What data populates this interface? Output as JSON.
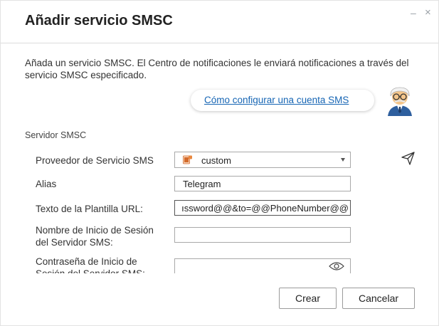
{
  "dialog": {
    "title": "Añadir servicio SMSC",
    "minimize": "–",
    "close": "×",
    "description": "Añada un servicio SMSC. El Centro de notificaciones le enviará notificaciones a través del servicio SMSC especificado.",
    "help_link": "Cómo configurar una cuenta SMS",
    "section_label": "Servidor SMSC"
  },
  "form": {
    "provider_label": "Proveedor de Servicio SMS",
    "provider_value": "custom",
    "alias_label": "Alias",
    "alias_value": "Telegram",
    "url_label": "Texto de la Plantilla URL:",
    "url_value": "ıssword@@&to=@@PhoneNumber@@",
    "login_label": "Nombre de Inicio de Sesión del Servidor SMS:",
    "login_value": "",
    "password_label": "Contraseña de Inicio de Sesión del Servidor SMS:",
    "password_value": ""
  },
  "buttons": {
    "create": "Crear",
    "cancel": "Cancelar"
  },
  "icons": {
    "provider": "custom-provider-icon",
    "send": "send-test-icon",
    "eye": "show-password-icon",
    "mascot": "helper-mascot"
  }
}
